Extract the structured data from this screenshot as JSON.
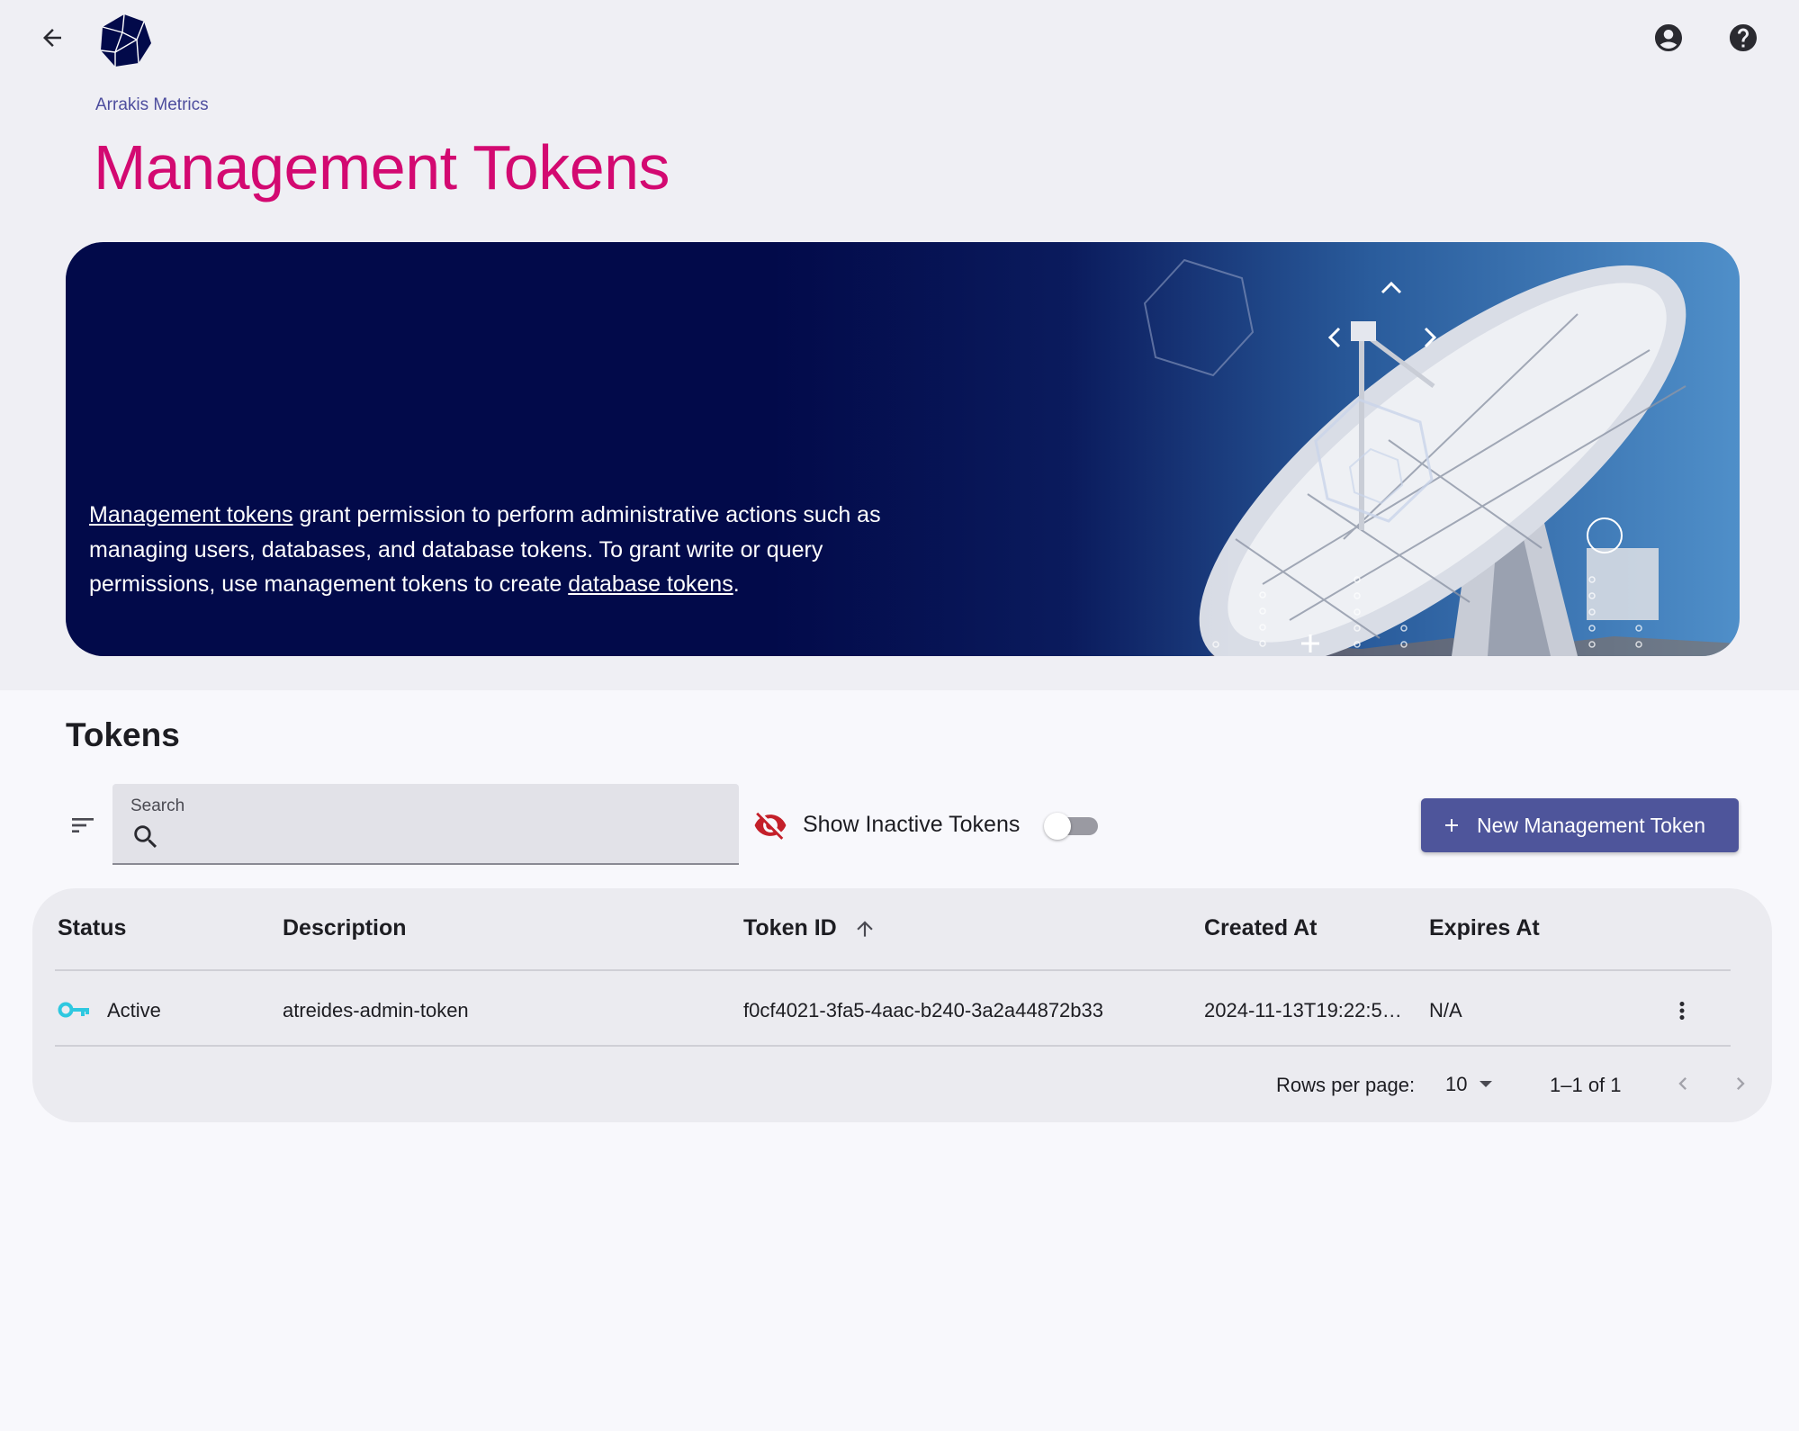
{
  "header": {
    "back_icon": "arrow-left-icon",
    "logo_icon": "polyhedron-logo-icon",
    "account_icon": "account-circle-icon",
    "help_icon": "help-circle-icon"
  },
  "breadcrumb": "Arrakis Metrics",
  "page_title": "Management Tokens",
  "banner": {
    "link1": "Management tokens",
    "text1": " grant permission to perform administrative actions such as managing users, databases, and database tokens. To grant write or query permissions, use management tokens to create ",
    "link2": "database tokens",
    "text2": ".",
    "image": "radio-telescope-dish"
  },
  "tokens_section": {
    "title": "Tokens",
    "filter_icon": "filter-list-icon",
    "search": {
      "label": "Search",
      "value": "",
      "icon": "search-icon"
    },
    "show_inactive": {
      "label": "Show Inactive Tokens",
      "checked": false,
      "icon": "eye-off-icon"
    },
    "new_button": {
      "label": "New Management Token",
      "icon": "plus-icon"
    }
  },
  "table": {
    "columns": [
      "Status",
      "Description",
      "Token ID",
      "Created At",
      "Expires At"
    ],
    "sort": {
      "column": "Token ID",
      "direction": "ascending",
      "icon": "arrow-up-icon"
    },
    "rows": [
      {
        "status": "Active",
        "status_icon": "key-icon",
        "description": "atreides-admin-token",
        "token_id": "f0cf4021-3fa5-4aac-b240-3a2a44872b33",
        "created_at": "2024-11-13T19:22:5…",
        "expires_at": "N/A",
        "menu_icon": "more-vert-icon"
      }
    ],
    "pagination": {
      "rows_per_page_label": "Rows per page:",
      "rows_per_page": "10",
      "range": "1–1 of 1"
    }
  },
  "colors": {
    "title": "#d30971",
    "breadcrumb": "#4d4d9e",
    "button": "#4e559b",
    "banner_dark": "#020a4a",
    "active_key": "#2ec8e0",
    "inactive_icon": "#c4202a"
  }
}
